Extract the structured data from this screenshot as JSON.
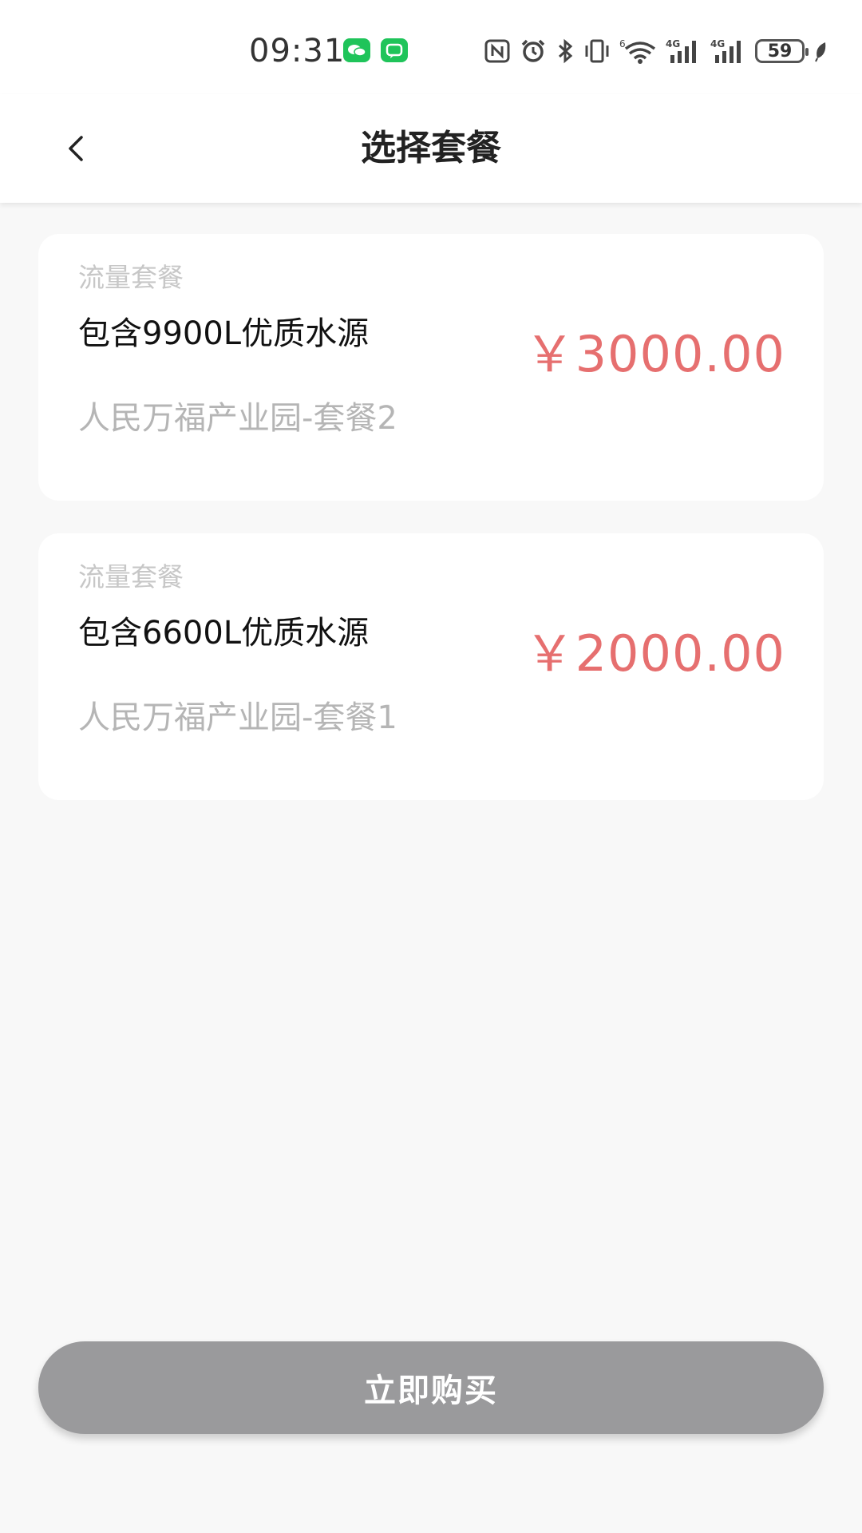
{
  "status_bar": {
    "time": "09:31",
    "battery": "59",
    "icons": [
      "wechat-icon",
      "message-icon",
      "nfc-icon",
      "alarm-icon",
      "bluetooth-icon",
      "vibrate-icon",
      "wifi-icon",
      "signal-4g-icon",
      "signal-4g-icon",
      "battery-icon",
      "leaf-icon"
    ]
  },
  "header": {
    "back_icon": "chevron-left-icon",
    "title": "选择套餐"
  },
  "packages": [
    {
      "category": "流量套餐",
      "title": "包含9900L优质水源",
      "subtitle": "人民万福产业园-套餐2",
      "price": "￥3000.00"
    },
    {
      "category": "流量套餐",
      "title": "包含6600L优质水源",
      "subtitle": "人民万福产业园-套餐1",
      "price": "￥2000.00"
    }
  ],
  "actions": {
    "buy_label": "立即购买"
  },
  "colors": {
    "price": "#e66f6f",
    "button_disabled": "#9a9a9c",
    "background": "#f8f8f8"
  }
}
